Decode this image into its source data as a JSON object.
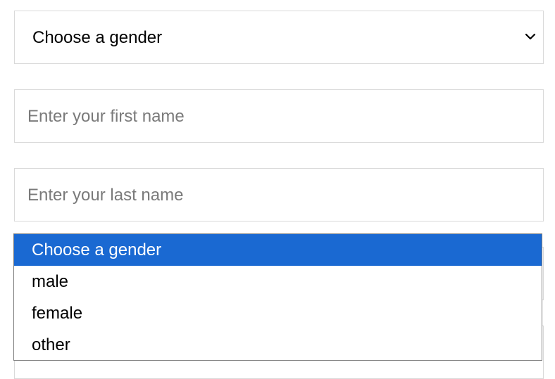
{
  "gender_select": {
    "value": "Choose a gender",
    "icon": "chevron-down-icon"
  },
  "first_name": {
    "placeholder": "Enter your first name"
  },
  "last_name": {
    "placeholder": "Enter your last name"
  },
  "dropdown": {
    "options": [
      {
        "label": "Choose a gender",
        "selected": true
      },
      {
        "label": "male",
        "selected": false
      },
      {
        "label": "female",
        "selected": false
      },
      {
        "label": "other",
        "selected": false
      }
    ],
    "highlight_color": "#1a69d2"
  }
}
